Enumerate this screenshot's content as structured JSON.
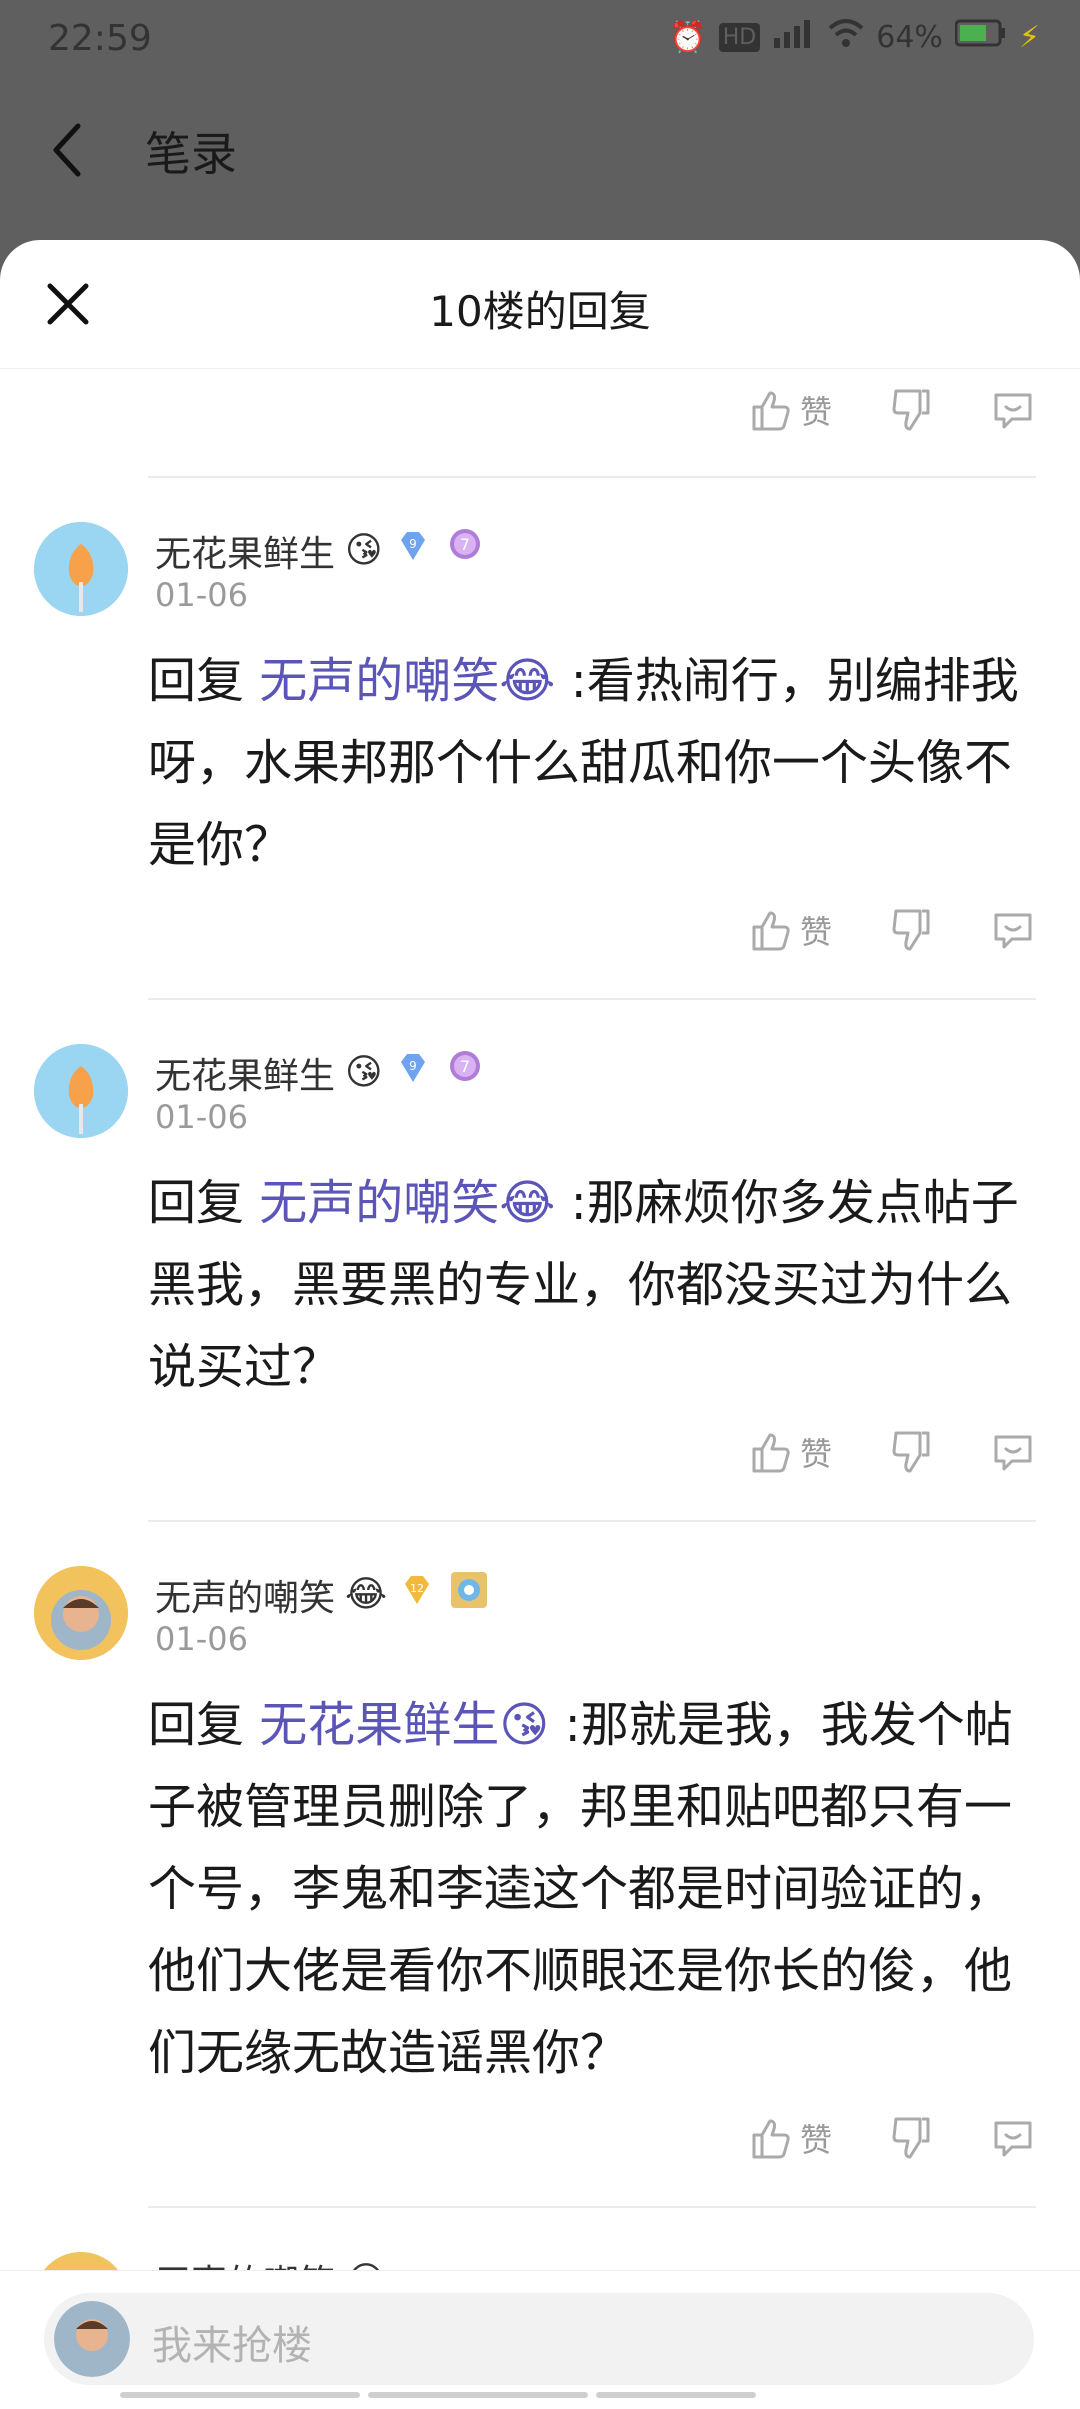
{
  "status": {
    "time": "22:59",
    "battery": "64%",
    "hd": "HD",
    "net": "4G"
  },
  "appbar": {
    "title": "笔录"
  },
  "sheet": {
    "title": "10楼的回复"
  },
  "action_labels": {
    "like": "赞"
  },
  "replies": [
    {
      "user": "无花果鲜生",
      "emoji": "😘",
      "level": "9",
      "badge": "7",
      "date": "01-06",
      "prefix": "回复 ",
      "mention": "无声的嘲笑😂",
      "text": "  :看热闹行，别编排我呀，水果邦那个什么甜瓜和你一个头像不是你？"
    },
    {
      "user": "无花果鲜生",
      "emoji": "😘",
      "level": "9",
      "badge": "7",
      "date": "01-06",
      "prefix": "回复 ",
      "mention": "无声的嘲笑😂",
      "text": "  :那麻烦你多发点帖子黑我，黑要黑的专业，你都没买过为什么说买过？"
    },
    {
      "user": "无声的嘲笑",
      "emoji": "😂",
      "level": "12",
      "badge": "",
      "date": "01-06",
      "prefix": "回复 ",
      "mention": "无花果鲜生😘",
      "text": "  :那就是我，我发个帖子被管理员删除了，邦里和贴吧都只有一个号，李鬼和李逵这个都是时间验证的，他们大佬是看你不顺眼还是你长的俊，他们无缘无故造谣黑你？"
    },
    {
      "user": "无声的嘲笑",
      "emoji": "😂",
      "level": "",
      "badge": "",
      "date": "",
      "prefix": "",
      "mention": "",
      "text": ""
    }
  ],
  "composer": {
    "placeholder": "我来抢楼"
  },
  "colors": {
    "mention": "#5b55b8",
    "level_blue": "#6fa3ef",
    "level_gold": "#f3b93c"
  }
}
